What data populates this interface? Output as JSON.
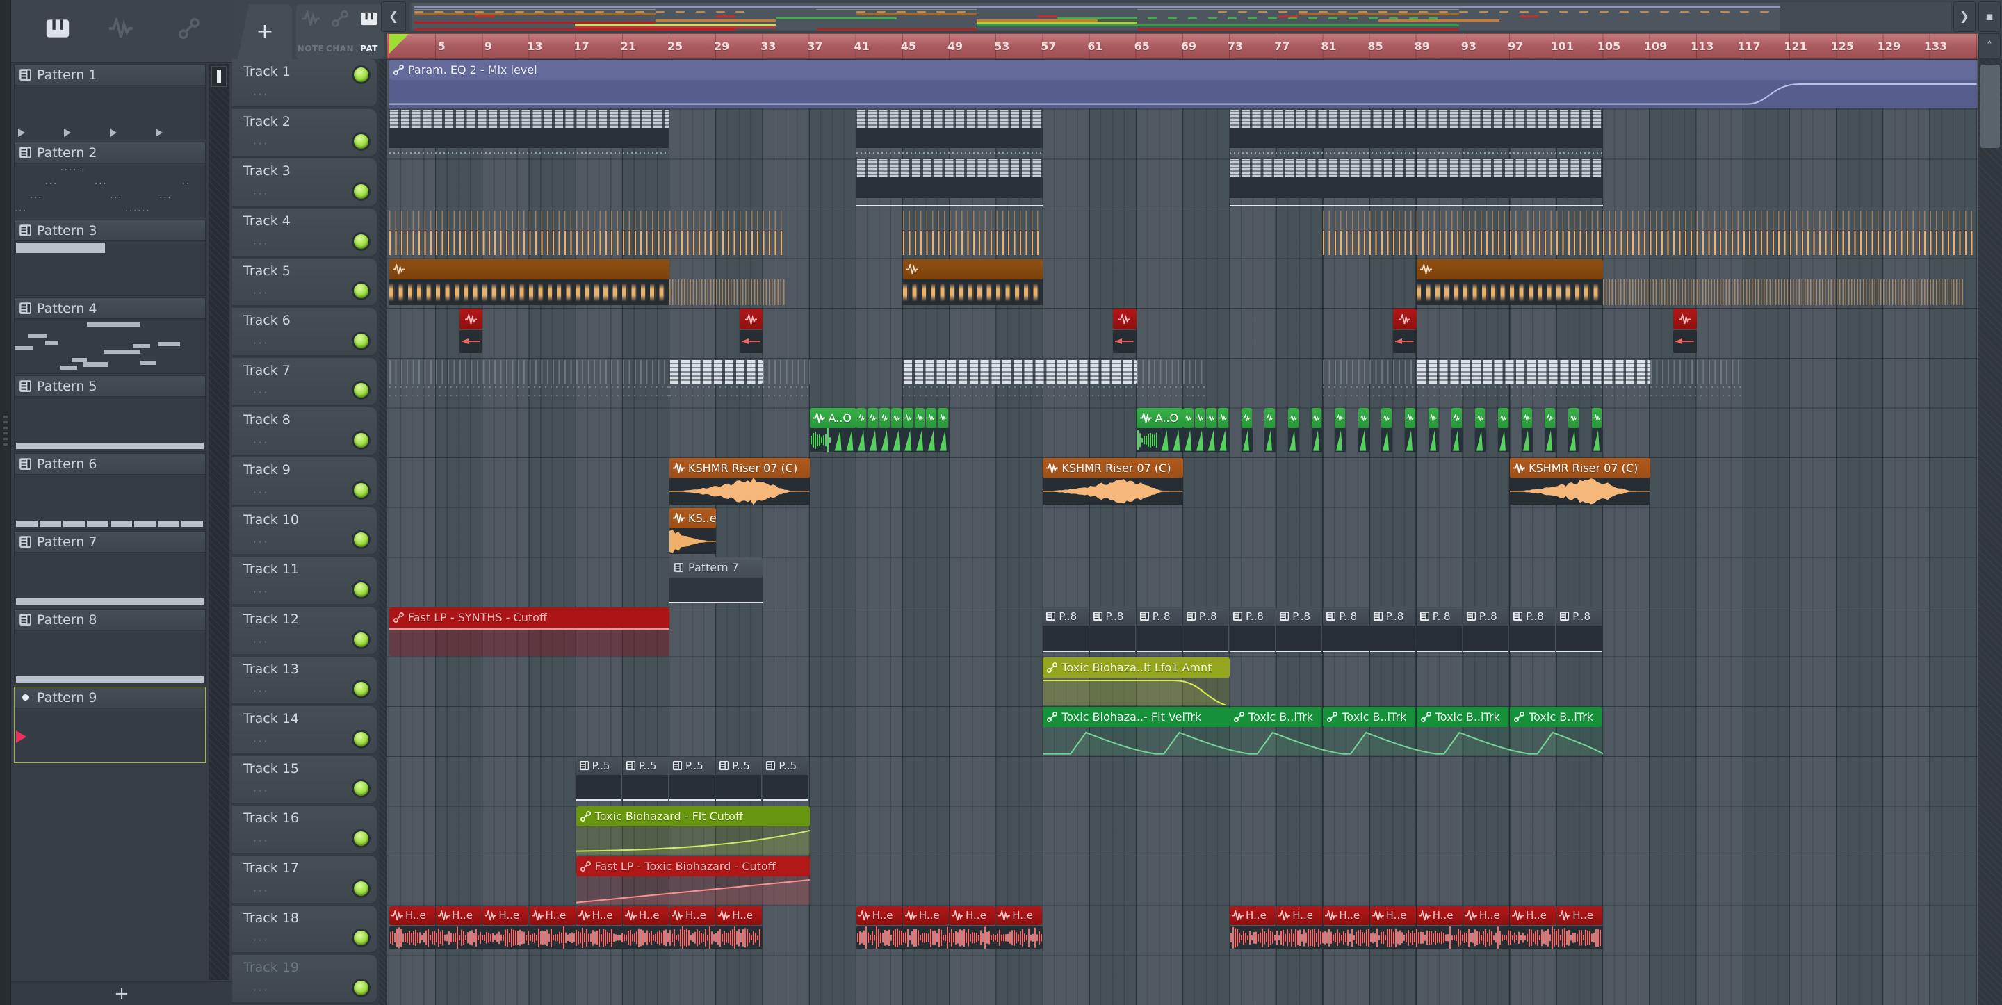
{
  "colors": {
    "accent_green_led": "#9ade3a",
    "ruler_red": "#a85a5e",
    "grid_bg": "#4a545c",
    "selection_border": "#a6b437",
    "orange_audio": "#f0ae66",
    "green_audio": "#38b046",
    "red_audio": "#a21616",
    "brown_audio": "#8a4c10"
  },
  "sidebar": {
    "tabs": [
      {
        "icon": "piano-icon",
        "active": true
      },
      {
        "icon": "wave-icon",
        "active": false
      },
      {
        "icon": "link-icon",
        "active": false
      }
    ],
    "add_label": "+",
    "patterns": [
      {
        "name": "Pattern 1",
        "preview": "arrows"
      },
      {
        "name": "Pattern 2",
        "preview": "dots"
      },
      {
        "name": "Pattern 3",
        "preview": "bar_top"
      },
      {
        "name": "Pattern 4",
        "preview": "notes"
      },
      {
        "name": "Pattern 5",
        "preview": "bar_bottom"
      },
      {
        "name": "Pattern 6",
        "preview": "bar_bottom_seg"
      },
      {
        "name": "Pattern 7",
        "preview": "bar_bottom"
      },
      {
        "name": "Pattern 8",
        "preview": "bar_bottom"
      },
      {
        "name": "Pattern 9",
        "preview": "empty",
        "selected": true,
        "playing": true,
        "bullet": true
      }
    ],
    "p4_notes": [
      [
        0.38,
        0.06,
        0.28,
        0.08
      ],
      [
        0.07,
        0.28,
        0.1,
        0.08
      ],
      [
        0.16,
        0.4,
        0.07,
        0.08
      ],
      [
        0.0,
        0.5,
        0.1,
        0.08
      ],
      [
        0.62,
        0.46,
        0.09,
        0.08
      ],
      [
        0.75,
        0.42,
        0.12,
        0.08
      ],
      [
        0.47,
        0.56,
        0.19,
        0.08
      ],
      [
        0.3,
        0.72,
        0.08,
        0.08
      ],
      [
        0.36,
        0.8,
        0.13,
        0.08
      ],
      [
        0.66,
        0.77,
        0.08,
        0.08
      ],
      [
        0.24,
        0.86,
        0.09,
        0.08
      ]
    ],
    "p2_dots": [
      [
        0.24,
        0.04,
        "······"
      ],
      [
        0.16,
        0.3,
        "···"
      ],
      [
        0.42,
        0.3,
        "···"
      ],
      [
        0.88,
        0.3,
        "··"
      ],
      [
        0.08,
        0.55,
        "···"
      ],
      [
        0.5,
        0.55,
        "···"
      ],
      [
        0.76,
        0.55,
        "···"
      ],
      [
        0.0,
        0.8,
        "···"
      ],
      [
        0.58,
        0.8,
        "······"
      ]
    ]
  },
  "toolbar": {
    "add_label": "+",
    "pickers": [
      {
        "label": "NOTE",
        "icon": "wave-icon",
        "active": false
      },
      {
        "label": "CHAN",
        "icon": "link-icon",
        "active": false
      },
      {
        "label": "PAT",
        "icon": "piano-icon",
        "active": true
      }
    ],
    "scroll_left": "❮",
    "scroll_right": "❯",
    "scroll_up": "˄",
    "mini_button": "▪"
  },
  "ruler": {
    "numbers": [
      5,
      9,
      13,
      17,
      21,
      25,
      29,
      33,
      37,
      41,
      45,
      49,
      53,
      57,
      61,
      65,
      69,
      73,
      77,
      81,
      85,
      89,
      93,
      97,
      101,
      105,
      109,
      113,
      117,
      121,
      125,
      129,
      133
    ]
  },
  "tracks": [
    {
      "name": "Track 1"
    },
    {
      "name": "Track 2"
    },
    {
      "name": "Track 3"
    },
    {
      "name": "Track 4"
    },
    {
      "name": "Track 5"
    },
    {
      "name": "Track 6"
    },
    {
      "name": "Track 7"
    },
    {
      "name": "Track 8"
    },
    {
      "name": "Track 9"
    },
    {
      "name": "Track 10"
    },
    {
      "name": "Track 11"
    },
    {
      "name": "Track 12"
    },
    {
      "name": "Track 13"
    },
    {
      "name": "Track 14"
    },
    {
      "name": "Track 15"
    },
    {
      "name": "Track 16"
    },
    {
      "name": "Track 17"
    },
    {
      "name": "Track 18"
    },
    {
      "name": "Track 19",
      "dim": true
    }
  ],
  "auto_styles": {
    "blue": {
      "hdr": "#646b9a",
      "body": "#575e8e",
      "line": "#b9c1e6",
      "text": "#eef0f8"
    },
    "red": {
      "hdr": "#ac1515",
      "body": "rgba(125,25,35,0.45)",
      "line": "#ff8f8f",
      "text": "#f4bcbc"
    },
    "olive": {
      "hdr": "#95a51d",
      "body": "rgba(140,155,35,0.22)",
      "line": "#dcec55",
      "text": "#f6ffd8"
    },
    "green": {
      "hdr": "#169139",
      "body": "rgba(25,120,60,0.16)",
      "line": "#86e6aa",
      "text": "#eafff2"
    },
    "lime": {
      "hdr": "#689611",
      "body": "rgba(120,150,25,0.20)",
      "line": "#cdea66",
      "text": "#f2ffd0"
    },
    "red2": {
      "hdr": "#b01818",
      "body": "rgba(140,25,30,0.22)",
      "line": "#ff9090",
      "text": "#f6bcbc"
    }
  },
  "clips": [
    {
      "track": 1,
      "bar": 1,
      "len": 136,
      "type": "auto",
      "style": "blue",
      "label": "Param. EQ 2 - Mix level",
      "curve": "rise_end"
    },
    {
      "track": 2,
      "bar": 1,
      "len": 24,
      "type": "blocks",
      "bottom": "dots"
    },
    {
      "track": 2,
      "bar": 41,
      "len": 16,
      "type": "blocks",
      "bottom": "dots"
    },
    {
      "track": 2,
      "bar": 73,
      "len": 32,
      "type": "blocks",
      "bottom": "dots"
    },
    {
      "track": 3,
      "bar": 41,
      "len": 16,
      "type": "blocks",
      "bottom": "line"
    },
    {
      "track": 3,
      "bar": 73,
      "len": 32,
      "type": "blocks",
      "bottom": "line"
    },
    {
      "track": 4,
      "bar": 1,
      "len": 34,
      "type": "ostripes"
    },
    {
      "track": 4,
      "bar": 45,
      "len": 12,
      "type": "ostripes"
    },
    {
      "track": 4,
      "bar": 81,
      "len": 56,
      "type": "ostripes"
    },
    {
      "track": 5,
      "bar": 1,
      "len": 24,
      "type": "audio_long"
    },
    {
      "track": 5,
      "bar": 25,
      "len": 10,
      "type": "otail"
    },
    {
      "track": 5,
      "bar": 45,
      "len": 12,
      "type": "audio_long"
    },
    {
      "track": 5,
      "bar": 89,
      "len": 16,
      "type": "audio_long"
    },
    {
      "track": 5,
      "bar": 105,
      "len": 31,
      "type": "otail"
    },
    {
      "track": 6,
      "bar": 7,
      "len": 2,
      "type": "stub"
    },
    {
      "track": 6,
      "bar": 31,
      "len": 2,
      "type": "stub"
    },
    {
      "track": 6,
      "bar": 63,
      "len": 2,
      "type": "stub"
    },
    {
      "track": 6,
      "bar": 87,
      "len": 2,
      "type": "stub"
    },
    {
      "track": 6,
      "bar": 111,
      "len": 2,
      "type": "stub"
    },
    {
      "track": 7,
      "bar": 1,
      "len": 24,
      "type": "dimstripes"
    },
    {
      "track": 7,
      "bar": 25,
      "len": 8,
      "type": "brightblocks"
    },
    {
      "track": 7,
      "bar": 33,
      "len": 4,
      "type": "dimstripes"
    },
    {
      "track": 7,
      "bar": 45,
      "len": 20,
      "type": "brightblocks"
    },
    {
      "track": 7,
      "bar": 65,
      "len": 6,
      "type": "dimstripes"
    },
    {
      "track": 7,
      "bar": 81,
      "len": 8,
      "type": "dimstripes"
    },
    {
      "track": 7,
      "bar": 89,
      "len": 20,
      "type": "brightblocks"
    },
    {
      "track": 7,
      "bar": 109,
      "len": 8,
      "type": "dimstripes"
    },
    {
      "track": 8,
      "bar": 37,
      "len": 12,
      "type": "greenwave"
    },
    {
      "track": 8,
      "bar": 37,
      "len": 4,
      "type": "audio_green",
      "label": "A..O"
    },
    {
      "track": 8,
      "bar": 41,
      "len": 8,
      "type": "minirun",
      "count": 8
    },
    {
      "track": 8,
      "bar": 65,
      "len": 8,
      "type": "greenwave"
    },
    {
      "track": 8,
      "bar": 65,
      "len": 4,
      "type": "audio_green",
      "label": "A..O"
    },
    {
      "track": 8,
      "bar": 69,
      "len": 4,
      "type": "minirun",
      "count": 4
    },
    {
      "track": 8,
      "bar": 74,
      "len": 31,
      "type": "singles",
      "count": 16,
      "step": 2
    },
    {
      "track": 9,
      "bar": 25,
      "len": 12,
      "type": "audio_riser",
      "label": "KSHMR Riser 07 (C)"
    },
    {
      "track": 9,
      "bar": 57,
      "len": 12,
      "type": "audio_riser",
      "label": "KSHMR Riser 07 (C)"
    },
    {
      "track": 9,
      "bar": 97,
      "len": 12,
      "type": "audio_riser",
      "label": "KSHMR Riser 07 (C)"
    },
    {
      "track": 10,
      "bar": 25,
      "len": 4,
      "type": "audio_decay",
      "label": "KS..e"
    },
    {
      "track": 11,
      "bar": 25,
      "len": 8,
      "type": "patclip",
      "label": "Pattern 7"
    },
    {
      "track": 12,
      "bar": 1,
      "len": 24,
      "type": "auto",
      "style": "red",
      "label": "Fast LP - SYNTHS - Cutoff",
      "curve": "flat_top"
    },
    {
      "track": 12,
      "bar": 57,
      "len": 48,
      "type": "patrun",
      "count": 12,
      "label": "P..8"
    },
    {
      "track": 13,
      "bar": 57,
      "len": 16,
      "type": "auto",
      "style": "olive",
      "label": "Toxic Biohaza..lt Lfo1 Amnt",
      "curve": "hold_drop"
    },
    {
      "track": 14,
      "bar": 57,
      "len": 48,
      "type": "teeth"
    },
    {
      "track": 14,
      "bar": 57,
      "len": 16,
      "type": "auto_hdr",
      "style": "green",
      "label": "Toxic Biohaza..- Flt VelTrk"
    },
    {
      "track": 14,
      "bar": 73,
      "len": 32,
      "type": "autorun",
      "count": 4,
      "style": "green",
      "label": "Toxic B..lTrk"
    },
    {
      "track": 15,
      "bar": 17,
      "len": 20,
      "type": "patrun",
      "count": 5,
      "label": "P..5"
    },
    {
      "track": 16,
      "bar": 17,
      "len": 20,
      "type": "auto",
      "style": "lime",
      "label": "Toxic Biohazard - Flt Cutoff",
      "curve": "exp_rise"
    },
    {
      "track": 17,
      "bar": 17,
      "len": 20,
      "type": "auto",
      "style": "red2",
      "label": "Fast LP - Toxic Biohazard - Cutoff",
      "curve": "lin_rise"
    },
    {
      "track": 18,
      "bar": 1,
      "len": 32,
      "type": "audiorun",
      "count": 8,
      "label": "H..e"
    },
    {
      "track": 18,
      "bar": 41,
      "len": 16,
      "type": "audiorun",
      "count": 4,
      "label": "H..e"
    },
    {
      "track": 18,
      "bar": 73,
      "len": 32,
      "type": "audiorun",
      "count": 8,
      "label": "H..e"
    }
  ],
  "minimap": {
    "rows": [
      {
        "y": 4,
        "h": 3,
        "color": "#8d95bb",
        "ranges": [
          [
            1,
            137
          ]
        ]
      },
      {
        "y": 8,
        "h": 2,
        "color": "#838b92",
        "ranges": [
          [
            1,
            25
          ],
          [
            41,
            57
          ],
          [
            73,
            105
          ]
        ]
      },
      {
        "y": 11,
        "h": 2,
        "color": "#c08a50",
        "dashed": true,
        "ranges": [
          [
            1,
            35
          ],
          [
            45,
            57
          ],
          [
            81,
            137
          ]
        ]
      },
      {
        "y": 14,
        "h": 3,
        "color": "#a9661f",
        "ranges": [
          [
            1,
            25
          ],
          [
            45,
            57
          ],
          [
            89,
            105
          ]
        ]
      },
      {
        "y": 17,
        "h": 3,
        "color": "#c22f2f",
        "ranges": [
          [
            7,
            9
          ],
          [
            31,
            33
          ],
          [
            63,
            65
          ],
          [
            87,
            89
          ],
          [
            111,
            113
          ]
        ]
      },
      {
        "y": 20,
        "h": 3,
        "color": "#3fae4a",
        "ranges": [
          [
            37,
            49
          ],
          [
            65,
            73
          ]
        ]
      },
      {
        "y": 20,
        "h": 3,
        "color": "#3fae4a",
        "dashed": true,
        "ranges": [
          [
            74,
            104
          ]
        ]
      },
      {
        "y": 23,
        "h": 3,
        "color": "#cd7a30",
        "ranges": [
          [
            25,
            37
          ],
          [
            57,
            69
          ],
          [
            97,
            109
          ]
        ]
      },
      {
        "y": 26,
        "h": 3,
        "color": "#b02020",
        "ranges": [
          [
            1,
            25
          ]
        ]
      },
      {
        "y": 26,
        "h": 3,
        "color": "#bac832",
        "ranges": [
          [
            57,
            73
          ]
        ]
      },
      {
        "y": 29,
        "h": 3,
        "color": "#cde05a",
        "ranges": [
          [
            17,
            37
          ]
        ]
      },
      {
        "y": 30,
        "h": 3,
        "color": "#2f9e3a",
        "ranges": [
          [
            57,
            105
          ]
        ]
      },
      {
        "y": 33,
        "h": 3,
        "color": "#c23434",
        "ranges": [
          [
            17,
            37
          ]
        ]
      },
      {
        "y": 36,
        "h": 3,
        "color": "#b02525",
        "ranges": [
          [
            1,
            33
          ],
          [
            41,
            57
          ],
          [
            73,
            105
          ]
        ]
      }
    ]
  }
}
